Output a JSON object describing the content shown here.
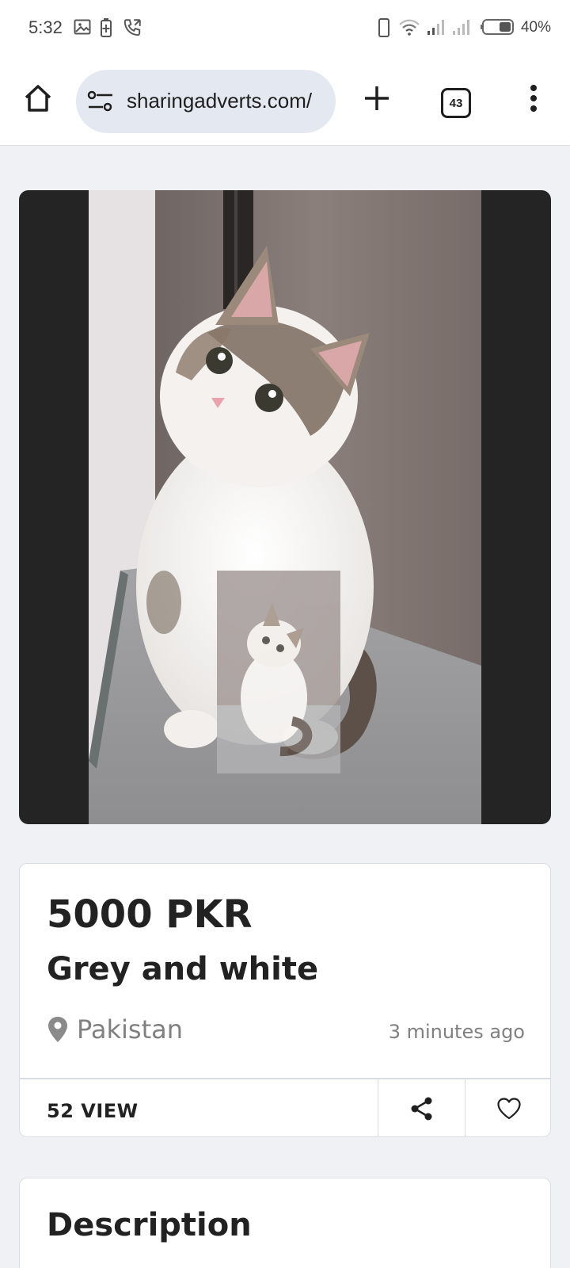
{
  "status_bar": {
    "time": "5:32",
    "battery_percent": "40%",
    "icons": [
      "image-icon",
      "battery-saver-icon",
      "phone-call-icon",
      "phone-vibrate-icon",
      "wifi-icon",
      "signal-icon",
      "signal-icon",
      "battery-icon"
    ]
  },
  "browser": {
    "url": "sharingadverts.com/",
    "tab_count": "43",
    "icons": [
      "home-icon",
      "site-settings-icon",
      "plus-icon",
      "more-vert-icon"
    ]
  },
  "listing": {
    "image_alt": "Tabby and white kitten sitting in a corner",
    "price": "5000 PKR",
    "title": "Grey and white",
    "location": "Pakistan",
    "posted": "3 minutes ago",
    "views": "52 VIEW"
  },
  "description": {
    "heading": "Description"
  },
  "colors": {
    "page_bg": "#eff1f5",
    "url_pill": "#e4e8f1",
    "photo_bg": "#242424",
    "muted_text": "#808080"
  }
}
